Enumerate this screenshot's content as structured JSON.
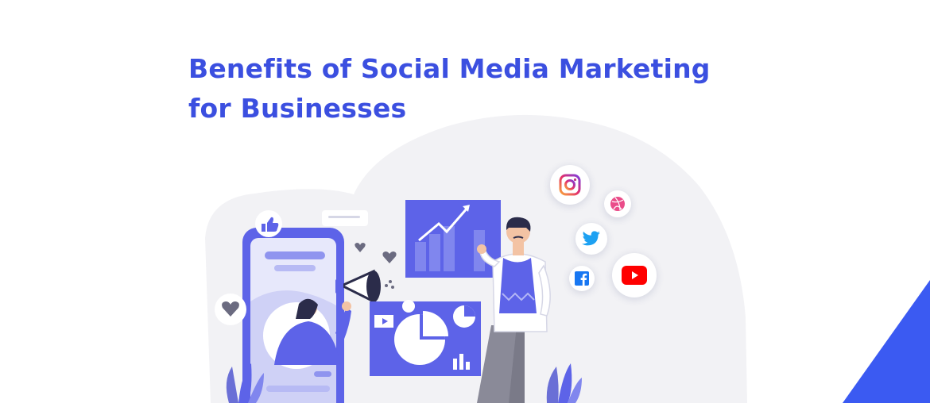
{
  "title": {
    "line1": "Benefits of Social Media Marketing",
    "line2": "for Businesses"
  },
  "colors": {
    "brand_blue": "#3b4fe0",
    "illustration_purple": "#5d63e8",
    "background_blob": "#f1f1f5",
    "corner_accent": "#3b5af2"
  },
  "icons": [
    "instagram-icon",
    "dribbble-icon",
    "twitter-icon",
    "facebook-icon",
    "youtube-icon",
    "thumbs-up-icon",
    "heart-icon",
    "megaphone-icon",
    "growth-chart-icon",
    "pie-chart-icon"
  ]
}
